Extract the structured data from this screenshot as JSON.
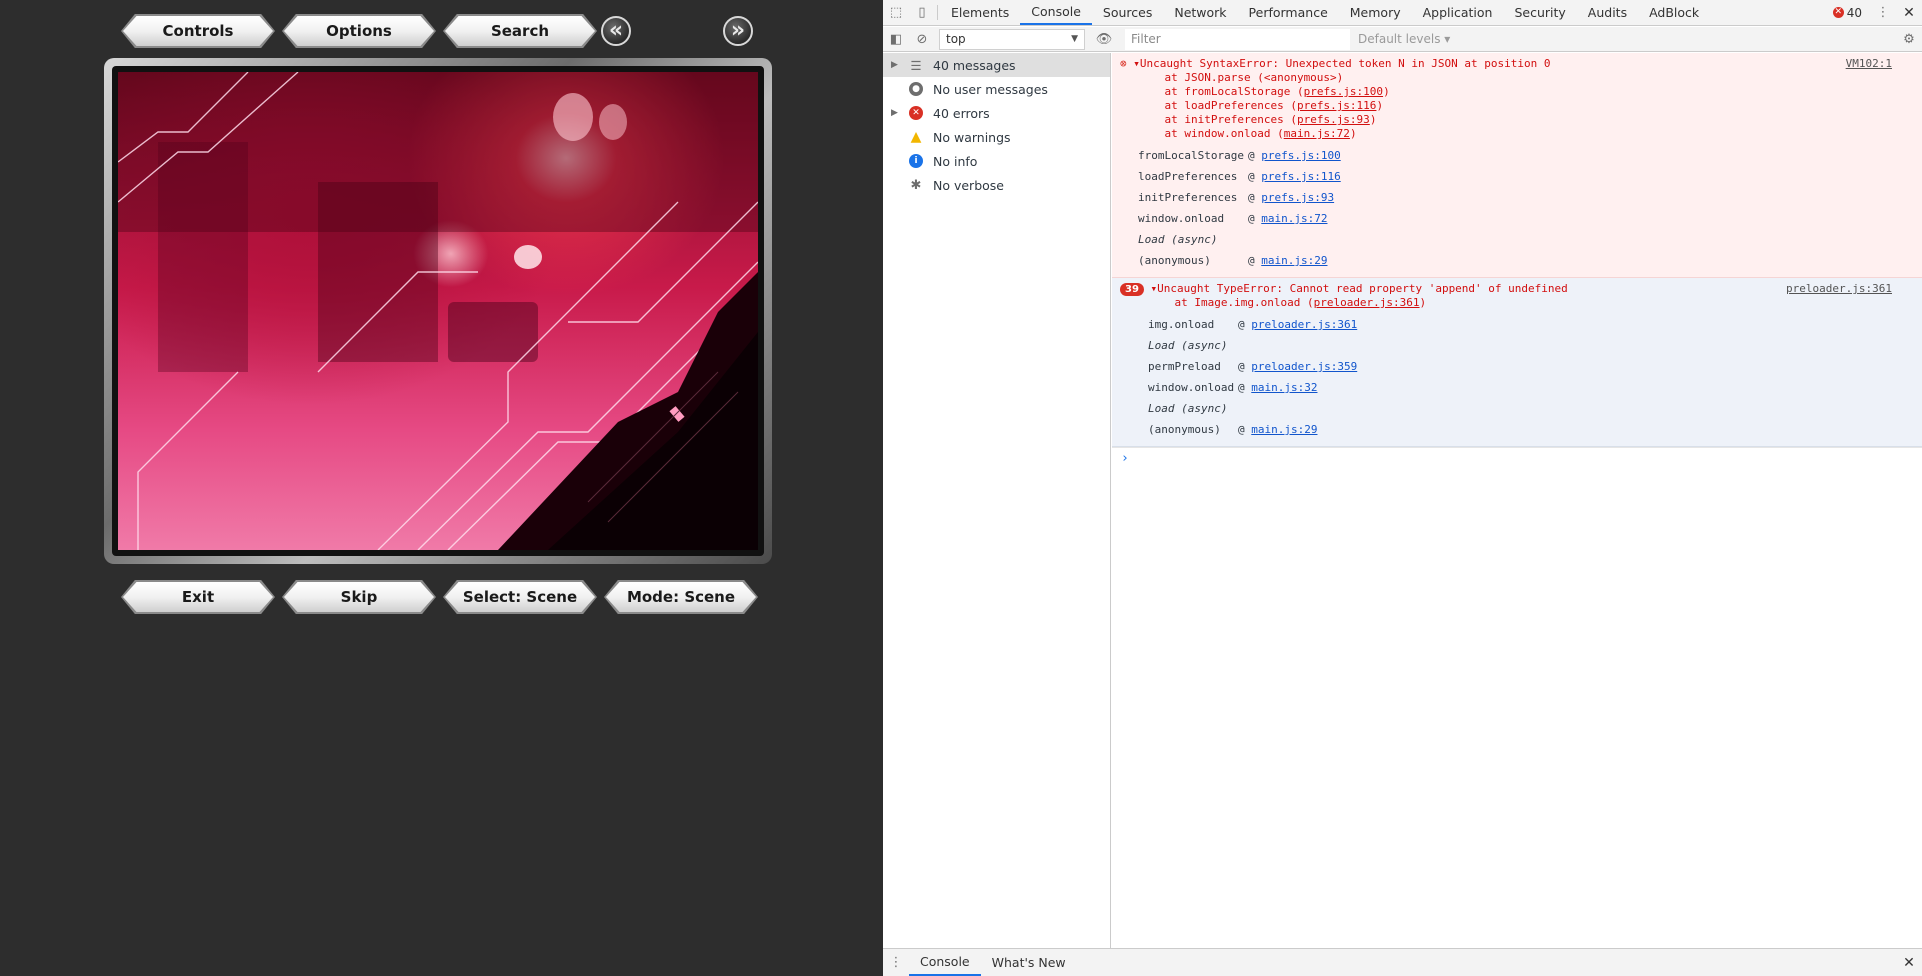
{
  "game": {
    "top_buttons": [
      "Controls",
      "Options",
      "Search"
    ],
    "nav_prev": "«",
    "nav_next": "»",
    "bottom_buttons": [
      "Exit",
      "Skip",
      "Select: Scene",
      "Mode: Scene"
    ]
  },
  "devtools": {
    "tabs": [
      "Elements",
      "Console",
      "Sources",
      "Network",
      "Performance",
      "Memory",
      "Application",
      "Security",
      "Audits",
      "AdBlock"
    ],
    "active_tab": "Console",
    "error_count": "40",
    "context": "top",
    "filter_placeholder": "Filter",
    "levels_label": "Default levels ▾",
    "sidebar": [
      {
        "label": "40 messages",
        "icon": "list-icon"
      },
      {
        "label": "No user messages",
        "icon": "user-icon"
      },
      {
        "label": "40 errors",
        "icon": "error-icon"
      },
      {
        "label": "No warnings",
        "icon": "warning-icon"
      },
      {
        "label": "No info",
        "icon": "info-icon"
      },
      {
        "label": "No verbose",
        "icon": "bug-icon"
      }
    ],
    "error1": {
      "lines": [
        "Uncaught SyntaxError: Unexpected token N in JSON at position 0",
        "    at JSON.parse (<anonymous>)",
        "    at fromLocalStorage (",
        "    at loadPreferences (",
        "    at initPreferences (",
        "    at window.onload ("
      ],
      "line_links": [
        "",
        "",
        "prefs.js:100",
        "prefs.js:116",
        "prefs.js:93",
        "main.js:72"
      ],
      "source": "VM102:1",
      "trace": [
        {
          "fn": "fromLocalStorage",
          "at": "@",
          "link": "prefs.js:100"
        },
        {
          "fn": "loadPreferences",
          "at": "@",
          "link": "prefs.js:116"
        },
        {
          "fn": "initPreferences",
          "at": "@",
          "link": "prefs.js:93"
        },
        {
          "fn": "window.onload",
          "at": "@",
          "link": "main.js:72"
        },
        {
          "fn": "Load (async)",
          "at": "",
          "link": ""
        },
        {
          "fn": "(anonymous)",
          "at": "@",
          "link": "main.js:29"
        }
      ]
    },
    "error2": {
      "count": "39",
      "lines": [
        "Uncaught TypeError: Cannot read property 'append' of undefined",
        "    at Image.img.onload ("
      ],
      "line_links": [
        "",
        "preloader.js:361"
      ],
      "source": "preloader.js:361",
      "trace": [
        {
          "fn": "img.onload",
          "at": "@",
          "link": "preloader.js:361"
        },
        {
          "fn": "Load (async)",
          "at": "",
          "link": ""
        },
        {
          "fn": "permPreload",
          "at": "@",
          "link": "preloader.js:359"
        },
        {
          "fn": "window.onload",
          "at": "@",
          "link": "main.js:32"
        },
        {
          "fn": "Load (async)",
          "at": "",
          "link": ""
        },
        {
          "fn": "(anonymous)",
          "at": "@",
          "link": "main.js:29"
        }
      ]
    },
    "prompt": "›",
    "drawer_tabs": [
      "Console",
      "What's New"
    ],
    "close": "✕"
  }
}
